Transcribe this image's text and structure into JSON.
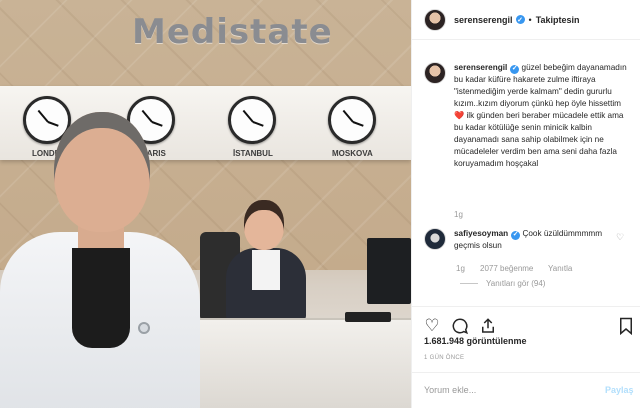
{
  "media": {
    "brand_sign": "Medistate",
    "clocks": [
      "LONDRA",
      "PARIS",
      "İSTANBUL",
      "MOSKOVA"
    ]
  },
  "header": {
    "username": "serenserengil",
    "separator": "•",
    "follow_label": "Takiptesin"
  },
  "caption": {
    "username": "serenserengil",
    "text": "güzel bebeğim dayanamadın bu kadar küfüre hakarete zulme iftiraya \"istenmediğim yerde kalmam\" dedin gururlu kızım..kızım diyorum çünkü hep öyle hissettim ❤️ ilk günden beri beraber mücadele ettik ama bu kadar kötülüğe senin minicik kalbin dayanamadı sana sahip olabilmek için ne mücadeleler verdim ben ama seni daha fazla koruyamadım hoşçakal",
    "age": "1g"
  },
  "comment": {
    "username": "safiyesoyman",
    "text": "Çook üzüldümmmmm geçmis olsun",
    "age": "1g",
    "likes": "2077 beğenme",
    "reply_label": "Yanıtla",
    "view_replies": "Yanıtları gör (94)"
  },
  "actions": {
    "views": "1.681.948 görüntülenme",
    "date": "1 GÜN ÖNCE"
  },
  "add_comment": {
    "placeholder": "Yorum ekle...",
    "submit_label": "Paylaş"
  },
  "colors": {
    "verified": "#3897f0",
    "meta_text": "#999999",
    "submit_disabled": "#b2dffc"
  }
}
